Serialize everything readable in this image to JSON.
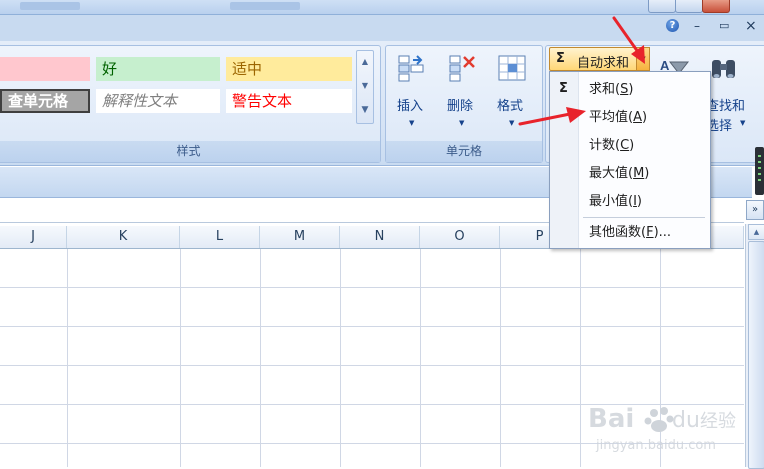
{
  "window": {
    "help_glyph": "?",
    "min_glyph": "–",
    "max_glyph": "▭",
    "close_glyph": "×"
  },
  "styles_group": {
    "label": "样式",
    "cells": {
      "bad": "",
      "good": "好",
      "neutral": "适中",
      "check": "查单元格",
      "explain": "解释性文本",
      "warn": "警告文本"
    }
  },
  "cells_group": {
    "label": "单元格",
    "insert": "插入",
    "delete": "删除",
    "format": "格式"
  },
  "editing_group": {
    "autosum_sigma": "Σ",
    "autosum_label": "自动求和",
    "find_select_line1": "查找和",
    "find_select_line2": "选择"
  },
  "menu": {
    "items": [
      {
        "text": "求和(",
        "key": "S",
        "tail": ")"
      },
      {
        "text": "平均值(",
        "key": "A",
        "tail": ")"
      },
      {
        "text": "计数(",
        "key": "C",
        "tail": ")"
      },
      {
        "text": "最大值(",
        "key": "M",
        "tail": ")"
      },
      {
        "text": "最小值(",
        "key": "I",
        "tail": ")"
      },
      {
        "text": "其他函数(",
        "key": "F",
        "tail": ")..."
      }
    ]
  },
  "columns": [
    "J",
    "K",
    "L",
    "M",
    "N",
    "O",
    "P"
  ],
  "expand_glyph": "»",
  "colors": {
    "arrow": "#e8232b",
    "accent_autosum": "#ffd777",
    "ribbon": "#dbe7f7"
  },
  "icons": [
    "insert-cells-icon",
    "delete-cells-icon",
    "format-cells-icon",
    "sort-filter-icon",
    "binoculars-icon",
    "sigma-icon"
  ],
  "watermark": {
    "brand": "Bai du 经验",
    "url": "jingyan.baidu.com"
  }
}
